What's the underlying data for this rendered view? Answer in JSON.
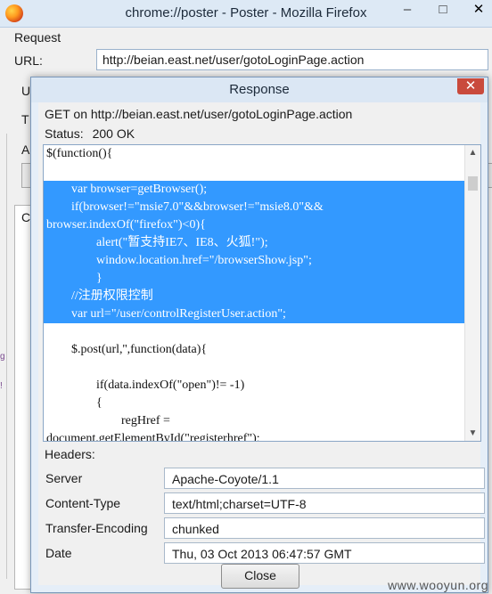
{
  "window": {
    "title": "chrome://poster - Poster - Mozilla Firefox"
  },
  "request": {
    "section_label": "Request",
    "url_label": "URL:",
    "url_value": "http://beian.east.net/user/gotoLoginPage.action",
    "peek_labels": [
      "U",
      "T",
      "A",
      "C"
    ]
  },
  "dialog": {
    "title": "Response",
    "request_line": "GET on http://beian.east.net/user/gotoLoginPage.action",
    "status_label": "Status:",
    "status_value": "200 OK",
    "code_lines": [
      "$(function(){",
      "",
      "        var browser=getBrowser();",
      "        if(browser!=\"msie7.0\"&&browser!=\"msie8.0\"&&",
      "browser.indexOf(\"firefox\")<0){",
      "                alert(\"暂支持IE7、IE8、火狐!\");",
      "                window.location.href=\"/browserShow.jsp\";",
      "                }",
      "        //注册权限控制",
      "        var url=\"/user/controlRegisterUser.action\";",
      "",
      "        $.post(url,'',function(data){",
      "",
      "                if(data.indexOf(\"open\")!= -1)",
      "                {",
      "                        regHref =",
      "document.getElementById(\"registerhref\");"
    ],
    "selected_lines": [
      2,
      3,
      4,
      5,
      6,
      7,
      8,
      9
    ],
    "headers_label": "Headers:",
    "headers": [
      {
        "name": "Server",
        "value": "Apache-Coyote/1.1"
      },
      {
        "name": "Content-Type",
        "value": "text/html;charset=UTF-8"
      },
      {
        "name": "Transfer-Encoding",
        "value": "chunked"
      },
      {
        "name": "Date",
        "value": "Thu, 03 Oct 2013 06:47:57 GMT"
      }
    ],
    "close_label": "Close"
  },
  "watermark": "www.wooyun.org"
}
